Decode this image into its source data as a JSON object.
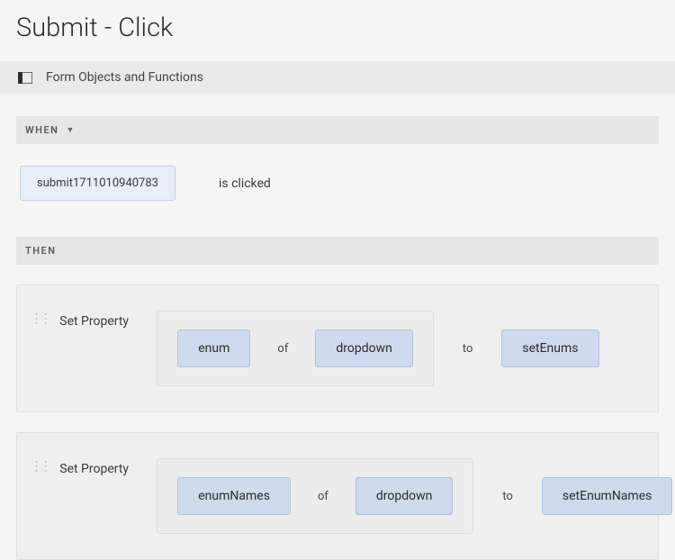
{
  "title": "Submit - Click",
  "toolbar": {
    "link_label": "Form Objects and Functions"
  },
  "when": {
    "header": "WHEN",
    "object_token": "submit1711010940783",
    "predicate": "is clicked"
  },
  "then": {
    "header": "THEN",
    "actions": [
      {
        "label": "Set Property",
        "prop_token": "enum",
        "of_word": "of",
        "target_token": "dropdown",
        "to_word": "to",
        "value_token": "setEnums"
      },
      {
        "label": "Set Property",
        "prop_token": "enumNames",
        "of_word": "of",
        "target_token": "dropdown",
        "to_word": "to",
        "value_token": "setEnumNames"
      }
    ]
  }
}
